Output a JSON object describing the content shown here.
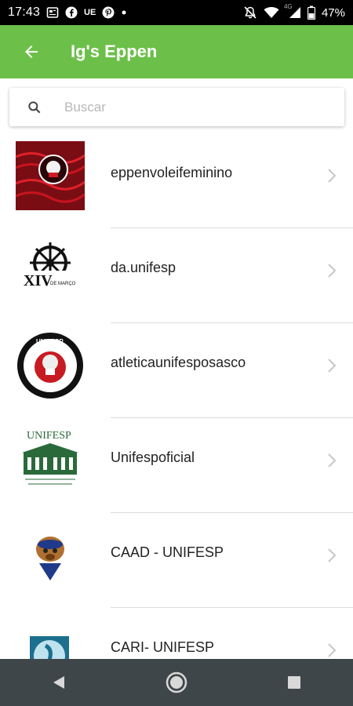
{
  "status_bar": {
    "time": "17:43",
    "left_icons": [
      "news-icon",
      "facebook-icon",
      "ue-text",
      "pinterest-icon",
      "dot"
    ],
    "ue_label": "UE",
    "network_label": "4G",
    "battery_percent": "47%"
  },
  "app_bar": {
    "title": "Ig's Eppen",
    "back_icon": "arrow-back-icon",
    "color": "#6cc04a"
  },
  "search": {
    "placeholder": "Buscar",
    "value": ""
  },
  "list": {
    "items": [
      {
        "label": "eppenvoleifeminino",
        "icon": "volleyball-logo"
      },
      {
        "label": "da.unifesp",
        "icon": "ship-wheel-xiv-logo",
        "logo_text": "XIV",
        "logo_subtext": "DE MARÇO"
      },
      {
        "label": "atleticaunifesposasco",
        "icon": "athletic-logo",
        "logo_text": "UNIFESP"
      },
      {
        "label": "Unifespoficial",
        "icon": "unifesp-building-logo",
        "logo_text": "UNIFESP"
      },
      {
        "label": "CAAD - UNIFESP",
        "icon": "dog-mascot-logo"
      },
      {
        "label": "CARI- UNIFESP",
        "icon": "cari-logo"
      }
    ]
  },
  "nav_bar": {
    "buttons": [
      "back-triangle-icon",
      "home-circle-icon",
      "recents-square-icon"
    ]
  }
}
